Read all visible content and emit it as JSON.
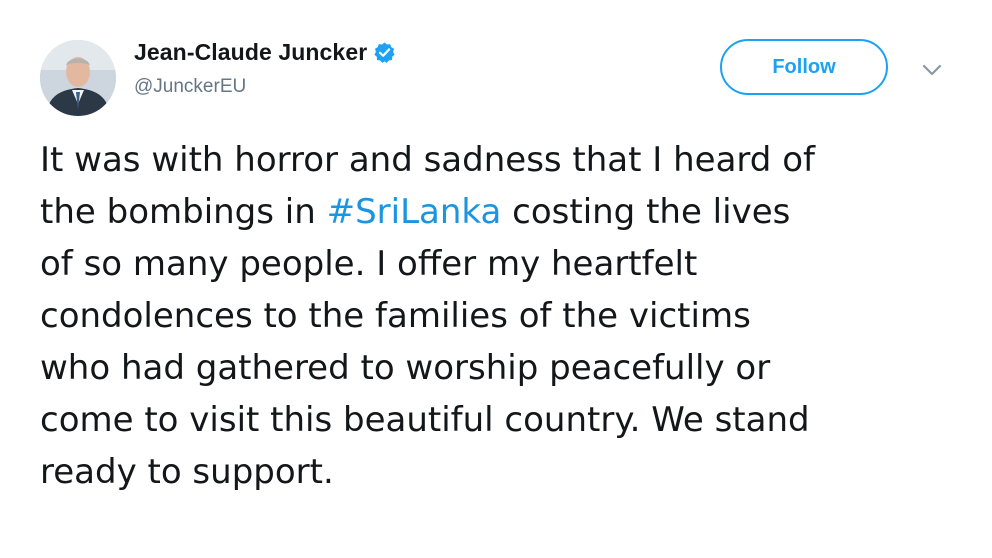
{
  "user": {
    "display_name": "Jean-Claude Juncker",
    "handle": "@JunckerEU",
    "verified": true,
    "avatar_icon": "profile-photo"
  },
  "actions": {
    "follow_label": "Follow",
    "menu_icon": "chevron-down-icon"
  },
  "tweet": {
    "lines": [
      {
        "before": "It was with horror and sadness that I heard of",
        "hashtag": "",
        "after": ""
      },
      {
        "before": "the bombings in ",
        "hashtag": "#SriLanka",
        "after": " costing the lives"
      },
      {
        "before": "of so many people. I offer my heartfelt",
        "hashtag": "",
        "after": ""
      },
      {
        "before": "condolences to the families of the victims",
        "hashtag": "",
        "after": ""
      },
      {
        "before": "who had gathered to worship peacefully or",
        "hashtag": "",
        "after": ""
      },
      {
        "before": "come to visit this beautiful country. We stand",
        "hashtag": "",
        "after": ""
      },
      {
        "before": "ready to support.",
        "hashtag": "",
        "after": ""
      }
    ]
  },
  "colors": {
    "accent": "#1da1f2",
    "hashtag": "#1b95e0",
    "text": "#14171a",
    "secondary_text": "#657786"
  }
}
